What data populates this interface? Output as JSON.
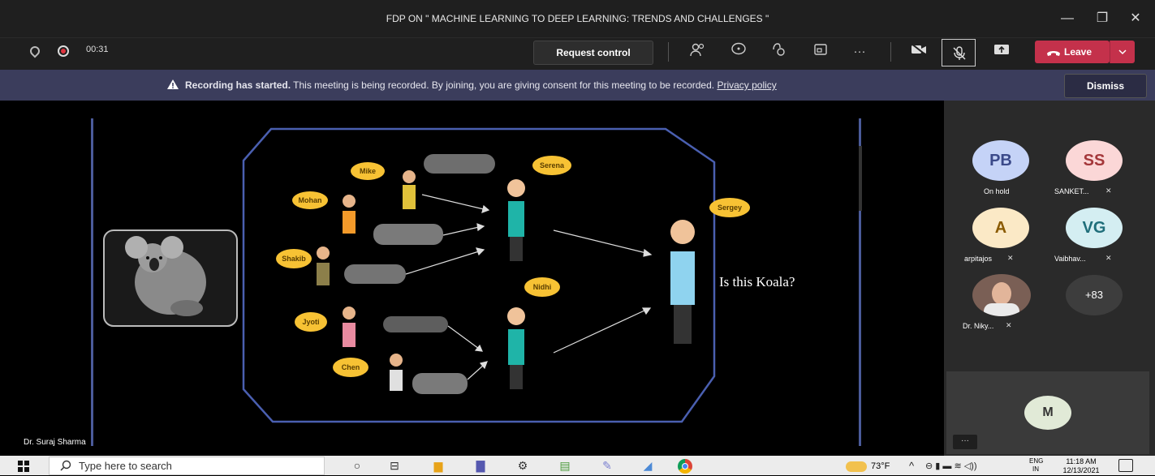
{
  "window": {
    "title": "FDP ON \" MACHINE LEARNING TO DEEP LEARNING: TRENDS AND CHALLENGES \"",
    "minimize": "—",
    "maximize": "❐",
    "close": "✕"
  },
  "toolbar": {
    "timer": "00:31",
    "request_control": "Request control",
    "more": "···",
    "leave": "Leave",
    "leave_icon": "phone-hangup-icon"
  },
  "banner": {
    "bold": "Recording has started.",
    "text": " This meeting is being recorded. By joining, you are giving consent for this meeting to be recorded. ",
    "link": "Privacy policy",
    "dismiss": "Dismiss"
  },
  "slide": {
    "question": "Is this Koala?",
    "speaker": "Dr. Suraj Sharma",
    "bubbles": [
      "Mike",
      "Mohan",
      "Shakib",
      "Jyoti",
      "Chen",
      "Serena",
      "Nidhi",
      "Sergey"
    ]
  },
  "participants": [
    {
      "initials": "PB",
      "name": "On hold",
      "bg": "#c5d3f7",
      "fg": "#3b4a8a"
    },
    {
      "initials": "SS",
      "name": "SANKET...",
      "bg": "#fbd7d7",
      "fg": "#a4373a"
    },
    {
      "initials": "A",
      "name": "arpitajos",
      "bg": "#fbe9c6",
      "fg": "#8a5a00"
    },
    {
      "initials": "VG",
      "name": "Vaibhav...",
      "bg": "#d4eef2",
      "fg": "#1f6e7a"
    },
    {
      "initials": "",
      "name": "Dr. Niky...",
      "bg": "#7a5f55",
      "fg": "#fff"
    },
    {
      "initials": "+83",
      "name": "",
      "bg": "#3d3d3d",
      "fg": "#fff"
    }
  ],
  "overflow_tile": {
    "initials": "M",
    "more": "···"
  },
  "taskbar": {
    "search_placeholder": "Type here to search",
    "weather": "73°F",
    "lang": "ENG",
    "region": "IN",
    "time": "11:18 AM",
    "date": "12/13/2021"
  }
}
